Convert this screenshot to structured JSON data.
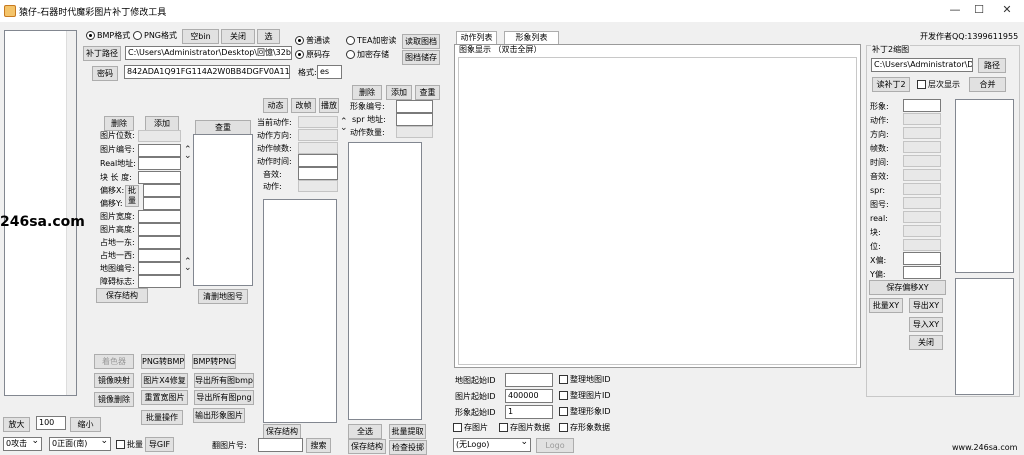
{
  "window": {
    "title": "猿仔-石器时代魔彩图片补丁修改工具",
    "author": "开发作者QQ:1399611955",
    "minimize": "—",
    "maximize": "☐",
    "close": "✕"
  },
  "top": {
    "bmp_radio": "BMP格式",
    "png_radio": "PNG格式",
    "empty_bin": "空bin",
    "close_btn": "关闭",
    "select_btn": "选",
    "patch_path_btn": "补丁路径",
    "path_value": "C:\\Users\\Administrator\\Desktop\\回憶\\32bin图",
    "password_btn": "密码",
    "password_value": "842ADA1Q91FG114A2W0BB4DGFV0A118A",
    "format_label": "格式:",
    "format_value": "es",
    "normal_read": "普通读",
    "raw_save": "原码存",
    "tea_read": "TEA加密读",
    "enc_save": "加密存储",
    "read_index": "读取图档",
    "index_save": "图档储存"
  },
  "left_panel": {
    "delete": "删除",
    "add": "添加",
    "query": "查重",
    "fields": [
      "图片位数:",
      "图片编号:",
      "Real地址:",
      "块 长 度:",
      "偏移X:",
      "偏移Y:",
      "图片宽度:",
      "图片高度:",
      "占地一东:",
      "占地一西:",
      "地图编号:",
      "障碍标志:"
    ],
    "batch": "批量",
    "save_struct": "保存结构",
    "clear_map": "清删地图号"
  },
  "anim_panel": {
    "dynamic": "动态",
    "change_frame": "改帧",
    "play": "播放",
    "fields": [
      "当前动作:",
      "动作方向:",
      "动作帧数:",
      "动作时间:",
      "音效:",
      "动作:"
    ],
    "save_struct": "保存结构"
  },
  "form_panel": {
    "delete": "删除",
    "add": "添加",
    "query": "查重",
    "fields": [
      "形象编号:",
      "spr 地址:",
      "动作数量:"
    ],
    "select_all": "全选",
    "batch_extract": "批量提取",
    "save_struct": "保存结构",
    "check_cast": "检查投掷"
  },
  "tools": {
    "bg_color": "着色器",
    "png2bmp": "PNG转BMP",
    "bmp2png": "BMP转PNG",
    "mirror_map": "镜像映射",
    "x4_fix": "图片X4修复",
    "export_bmp": "导出所有图bmp",
    "mirror_del": "镜像删除",
    "reset_img": "重置宽图片",
    "export_png": "导出所有图png",
    "batch_op": "批量操作",
    "export_form": "输出形象图片"
  },
  "bottom": {
    "zoom_in": "放大",
    "zoom_value": "100",
    "zoom_out": "缩小",
    "attack_combo": "0攻击",
    "direction_combo": "0正面(南)",
    "batch_chk": "批量",
    "export_gif": "导GIF",
    "img_num_label": "翻图片号:",
    "search": "搜索"
  },
  "center": {
    "tab_actions": "动作列表",
    "tab_forms": "形象列表",
    "display_label": "图象显示  （双击全屏）",
    "map_start_label": "地图起始ID",
    "img_start_label": "图片起始ID",
    "img_start_value": "400000",
    "form_start_label": "形象起始ID",
    "form_start_value": "1",
    "sort_map": "整理地图ID",
    "sort_img": "整理图片ID",
    "sort_form": "整理形象ID",
    "save_img": "存图片",
    "save_img_data": "存图片数据",
    "save_form_data": "存形象数据",
    "logo_combo": "(无Logo)",
    "logo_btn": "Logo"
  },
  "patch2": {
    "group_title": "补丁2缩图",
    "path_value": "C:\\Users\\Administrator\\Desk",
    "path_btn": "路径",
    "read_btn": "读补丁2",
    "layer_chk": "层次显示",
    "merge": "合并",
    "fields": [
      "形象:",
      "动作:",
      "方向:",
      "帧数:",
      "时间:",
      "音效:",
      "spr:",
      "图号:",
      "real:",
      "块:",
      "位:",
      "X偏:",
      "Y偏:"
    ],
    "save_offset": "保存偏移XY",
    "batch_xy": "批量XY",
    "export_xy": "导出XY",
    "import_xy": "导入XY",
    "close": "关闭"
  },
  "watermark": {
    "left": "246sa.com",
    "right": "www.246sa.com"
  }
}
